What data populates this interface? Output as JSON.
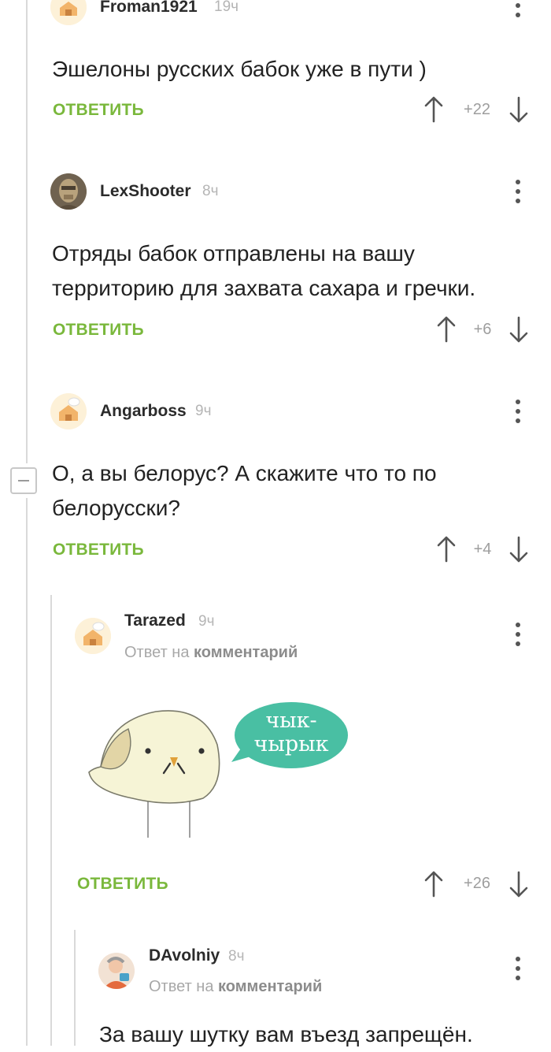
{
  "comments": [
    {
      "author": "Froman1921",
      "time": "19ч",
      "text": "Эшелоны русских бабок уже в пути )",
      "reply_label": "ОТВЕТИТЬ",
      "score": "+22"
    },
    {
      "author": "LexShooter",
      "time": "8ч",
      "text": "Отряды бабок отправлены на вашу территорию для захвата сахара и гречки.",
      "reply_label": "ОТВЕТИТЬ",
      "score": "+6"
    },
    {
      "author": "Angarboss",
      "time": "9ч",
      "text": "О, а вы белорус? А скажите что то по белорусски?",
      "reply_label": "ОТВЕТИТЬ",
      "score": "+4"
    },
    {
      "author": "Tarazed",
      "time": "9ч",
      "reply_to_prefix": "Ответ на",
      "reply_to_link": "комментарий",
      "image_bubble_text_1": "чык-",
      "image_bubble_text_2": "чырык",
      "reply_label": "ОТВЕТИТЬ",
      "score": "+26"
    },
    {
      "author": "DAvolniy",
      "time": "8ч",
      "reply_to_prefix": "Ответ на",
      "reply_to_link": "комментарий",
      "text": "За вашу шутку вам въезд запрещён."
    }
  ],
  "icons": {
    "upvote": "arrow-up-icon",
    "downvote": "arrow-down-icon",
    "more": "more-vertical-icon",
    "collapse": "collapse-minus-icon"
  },
  "colors": {
    "reply_green": "#7ab83c",
    "bubble_teal": "#49bfa3",
    "thread_line": "#d9d9d9"
  }
}
